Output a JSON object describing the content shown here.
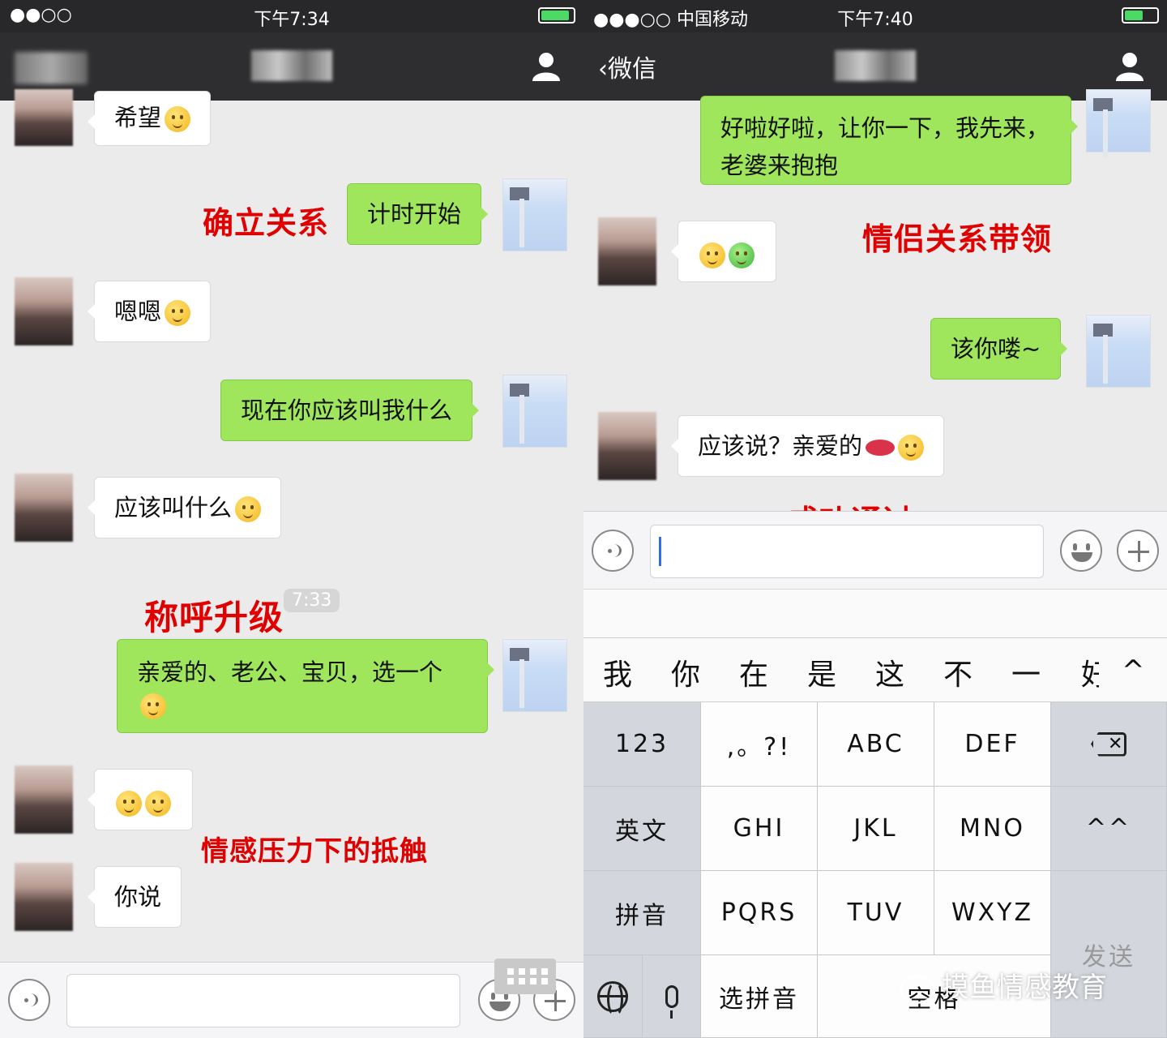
{
  "left": {
    "status": {
      "carrier": "●●○○",
      "time": "下午7:34"
    },
    "messages": {
      "m1": "希望",
      "m2": "计时开始",
      "m3": "嗯嗯",
      "m4": "现在你应该叫我什么",
      "m5": "应该叫什么",
      "m6": "亲爱的、老公、宝贝，选一个",
      "m8": "你说"
    },
    "timestamp": "7:33",
    "annotations": {
      "a1": "确立关系",
      "a2": "称呼升级",
      "a3": "情感压力下的抵触"
    }
  },
  "right": {
    "status": {
      "carrier": "●●●○○ 中国移动",
      "time": "下午7:40"
    },
    "nav": {
      "back_label": "微信"
    },
    "messages": {
      "m1": "好啦好啦，让你一下，我先来，老婆来抱抱",
      "m3": "该你喽~",
      "m4": "应该说？亲爱的"
    },
    "annotations": {
      "a1": "情侣关系带领",
      "a2": "成功通过"
    },
    "keyboard": {
      "suggestions": [
        "我",
        "你",
        "在",
        "是",
        "这",
        "不",
        "一",
        "好"
      ],
      "expand": "^",
      "row1": [
        "123",
        ",。?!",
        "ABC",
        "DEF"
      ],
      "row2": [
        "英文",
        "GHI",
        "JKL",
        "MNO",
        "^^"
      ],
      "row3": [
        "拼音",
        "PQRS",
        "TUV",
        "WXYZ"
      ],
      "row4": {
        "choose": "选拼音",
        "space": "空格",
        "send": "发送"
      }
    }
  },
  "watermark": "摸鱼情感教育",
  "colors": {
    "bubble_green": "#9fe65c",
    "annotation_red": "#e00000",
    "nav_bg": "#2e2e30",
    "caret_blue": "#2f6ee8"
  }
}
